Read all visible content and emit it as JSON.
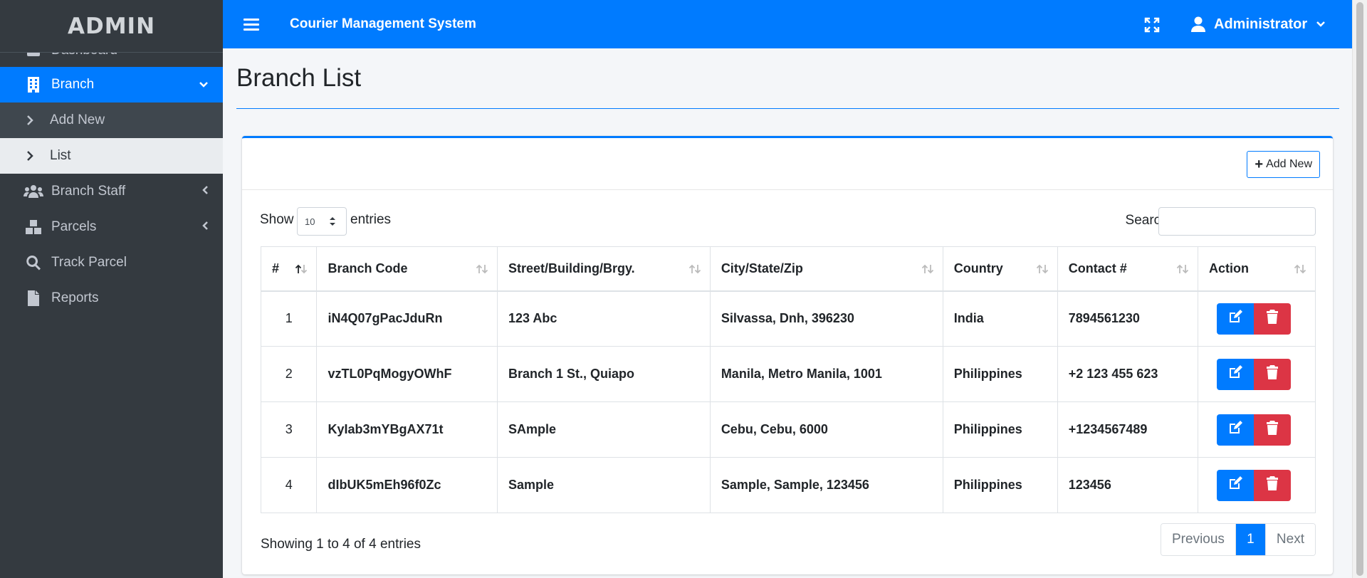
{
  "sidebar": {
    "brand": "ADMIN",
    "clipped_item": "Dashboard",
    "items": [
      {
        "label": "Branch",
        "icon": "building-icon",
        "active": true
      },
      {
        "label": "Add New",
        "icon": "chevron-right-icon"
      },
      {
        "label": "List",
        "icon": "chevron-right-icon"
      },
      {
        "label": "Branch Staff",
        "icon": "users-icon"
      },
      {
        "label": "Parcels",
        "icon": "boxes-icon"
      },
      {
        "label": "Track Parcel",
        "icon": "search-icon"
      },
      {
        "label": "Reports",
        "icon": "file-icon"
      }
    ]
  },
  "topbar": {
    "title": "Courier Management System",
    "user": "Administrator",
    "icons": [
      "menu-icon",
      "fullscreen-icon",
      "user-icon",
      "chevron-down-icon"
    ]
  },
  "page": {
    "title": "Branch List"
  },
  "card": {
    "add_new_label": "Add New"
  },
  "datatable": {
    "show_label": "Show",
    "length_value": "10",
    "entries_label": "entries",
    "search_label": "Search:",
    "search_value": "",
    "columns": [
      "#",
      "Branch Code",
      "Street/Building/Brgy.",
      "City/State/Zip",
      "Country",
      "Contact #",
      "Action"
    ],
    "rows": [
      [
        "1",
        "iN4Q07gPacJduRn",
        "123 Abc",
        "Silvassa, Dnh, 396230",
        "India",
        "7894561230"
      ],
      [
        "2",
        "vzTL0PqMogyOWhF",
        "Branch 1 St., Quiapo",
        "Manila, Metro Manila, 1001",
        "Philippines",
        "+2 123 455 623"
      ],
      [
        "3",
        "KyIab3mYBgAX71t",
        "SAmple",
        "Cebu, Cebu, 6000",
        "Philippines",
        "+1234567489"
      ],
      [
        "4",
        "dIbUK5mEh96f0Zc",
        "Sample",
        "Sample, Sample, 123456",
        "Philippines",
        "123456"
      ]
    ],
    "info": "Showing 1 to 4 of 4 entries",
    "pagination": {
      "previous": "Previous",
      "current": "1",
      "next": "Next"
    }
  },
  "colors": {
    "primary": "#007bff",
    "danger": "#dc3545",
    "sidebar_bg": "#343a40"
  }
}
